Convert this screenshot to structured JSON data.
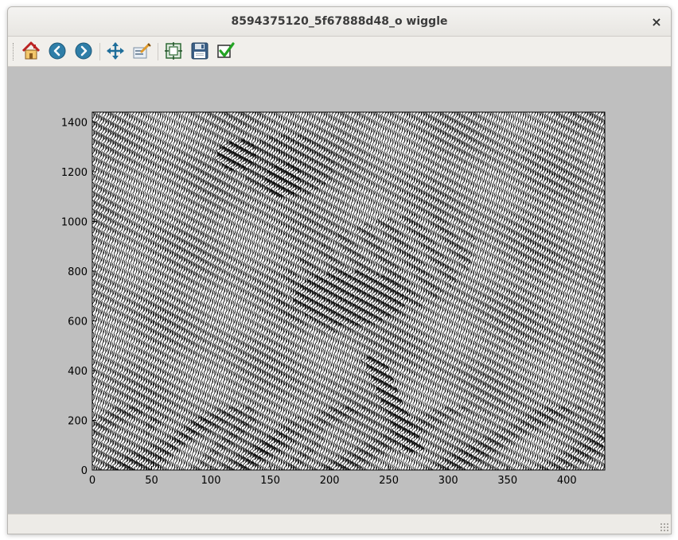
{
  "window": {
    "title": "8594375120_5f67888d48_o wiggle",
    "close_glyph": "×"
  },
  "toolbar": {
    "buttons": [
      {
        "name": "home-button",
        "icon": "home-icon",
        "tooltip": "Reset original view"
      },
      {
        "name": "back-button",
        "icon": "arrow-left-icon",
        "tooltip": "Back to previous view"
      },
      {
        "name": "forward-button",
        "icon": "arrow-right-icon",
        "tooltip": "Forward to next view"
      },
      {
        "name": "pan-button",
        "icon": "move-arrows-icon",
        "tooltip": "Pan axes"
      },
      {
        "name": "zoom-button",
        "icon": "zoom-rect-icon",
        "tooltip": "Zoom to rectangle"
      },
      {
        "name": "subplots-button",
        "icon": "subplots-icon",
        "tooltip": "Configure subplots"
      },
      {
        "name": "save-button",
        "icon": "floppy-disk-icon",
        "tooltip": "Save the figure"
      },
      {
        "name": "edit-button",
        "icon": "checkmark-icon",
        "tooltip": "Edit axis, curve and image parameters"
      }
    ]
  },
  "colors": {
    "canvas_bg": "#bfbfbf",
    "plot_bg": "#ffffff",
    "lines": "#000000"
  },
  "chart_data": {
    "type": "line",
    "description_series": "wiggle plot — dense vertical wiggling traces forming a grayscale image of a quail",
    "x_ticks": [
      "0",
      "50",
      "100",
      "150",
      "200",
      "250",
      "300",
      "350",
      "400"
    ],
    "y_ticks": [
      "0",
      "200",
      "400",
      "600",
      "800",
      "1000",
      "1200",
      "1400"
    ],
    "xlim": [
      0,
      432
    ],
    "ylim": [
      0,
      1440
    ],
    "grid": false
  }
}
